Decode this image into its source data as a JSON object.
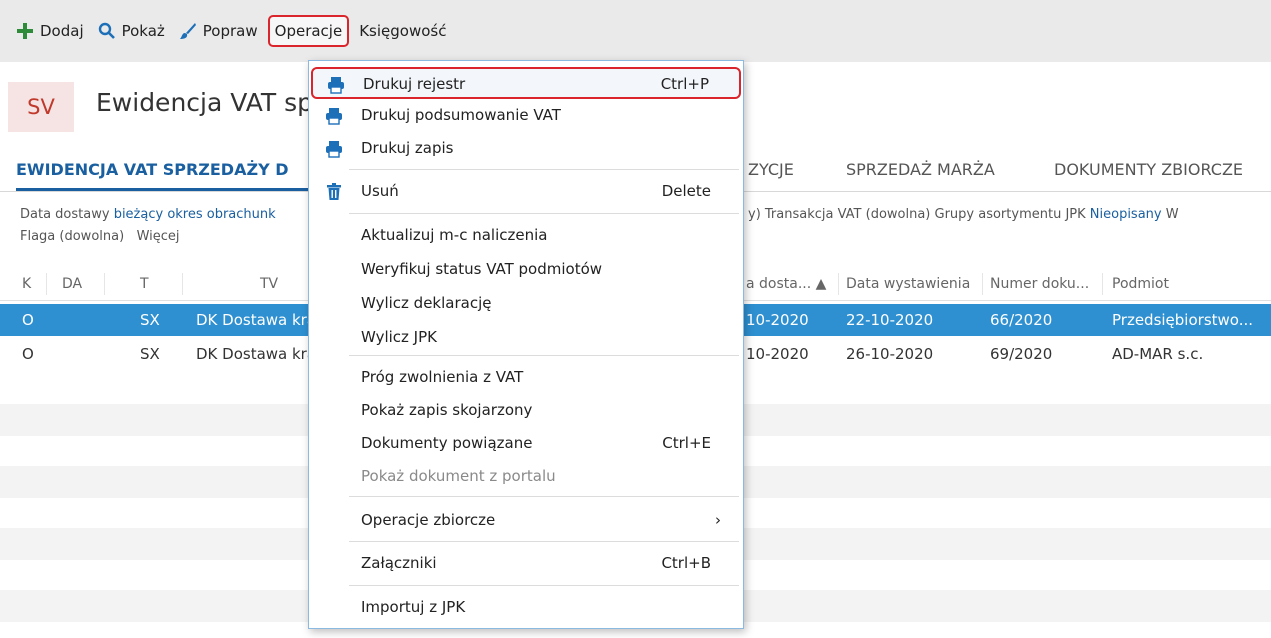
{
  "toolbar": {
    "items": [
      {
        "label": "Dodaj",
        "icon": "plus-icon"
      },
      {
        "label": "Pokaż",
        "icon": "search-icon"
      },
      {
        "label": "Popraw",
        "icon": "brush-icon"
      },
      {
        "label": "Operacje"
      },
      {
        "label": "Księgowość"
      }
    ]
  },
  "header": {
    "badge": "SV",
    "title": "Ewidencja VAT sp"
  },
  "tabs": [
    {
      "label": "EWIDENCJA VAT SPRZEDAŻY D"
    },
    {
      "label": "ZYCJE"
    },
    {
      "label": "SPRZEDAŻ MARŻA"
    },
    {
      "label": "DOKUMENTY ZBIORCZE"
    }
  ],
  "filters": {
    "line1": {
      "label1": "Data dostawy",
      "value1": "bieżący okres obrachunk",
      "tail": "y)  Transakcja VAT (dowolna)  Grupy asortymentu JPK",
      "value2": "Nieopisany",
      "end": "W"
    },
    "line2": {
      "flag": "Flaga (dowolna)",
      "more": "Więcej"
    }
  },
  "grid": {
    "headers": [
      "K",
      "DA",
      "T",
      "TV",
      "a dosta...",
      "Data wystawienia",
      "Numer doku...",
      "Podmiot"
    ],
    "rows": [
      {
        "k": "O",
        "da": "",
        "t": "SX",
        "tv": "DK Dostawa kra",
        "date1": "10-2020",
        "date2": "22-10-2020",
        "num": "66/2020",
        "entity": "Przedsiębiorstwo..."
      },
      {
        "k": "O",
        "da": "",
        "t": "SX",
        "tv": "DK Dostawa kra",
        "date1": "10-2020",
        "date2": "26-10-2020",
        "num": "69/2020",
        "entity": "AD-MAR s.c."
      }
    ]
  },
  "menu": {
    "items": [
      {
        "label": "Drukuj rejestr",
        "shortcut": "Ctrl+P",
        "icon": "printer-icon"
      },
      {
        "label": "Drukuj podsumowanie VAT",
        "shortcut": "",
        "icon": "printer-icon"
      },
      {
        "label": "Drukuj zapis",
        "shortcut": "",
        "icon": "printer-icon"
      },
      {
        "label": "Usuń",
        "shortcut": "Delete",
        "icon": "trash-icon"
      },
      {
        "label": "Aktualizuj m-c naliczenia",
        "shortcut": ""
      },
      {
        "label": "Weryfikuj status VAT podmiotów",
        "shortcut": ""
      },
      {
        "label": "Wylicz deklarację",
        "shortcut": ""
      },
      {
        "label": "Wylicz JPK",
        "shortcut": ""
      },
      {
        "label": "Próg zwolnienia z VAT",
        "shortcut": ""
      },
      {
        "label": "Pokaż zapis skojarzony",
        "shortcut": ""
      },
      {
        "label": "Dokumenty powiązane",
        "shortcut": "Ctrl+E"
      },
      {
        "label": "Pokaż dokument z portalu",
        "shortcut": ""
      },
      {
        "label": "Operacje zbiorcze",
        "shortcut": "›"
      },
      {
        "label": "Załączniki",
        "shortcut": "Ctrl+B"
      },
      {
        "label": "Importuj z JPK",
        "shortcut": ""
      }
    ]
  },
  "colors": {
    "accent": "#1a5fa0",
    "selection": "#2e90d1",
    "highlight_border": "#d9252b",
    "plus_green": "#2e8b3a",
    "printer_blue": "#1d6fb8"
  }
}
